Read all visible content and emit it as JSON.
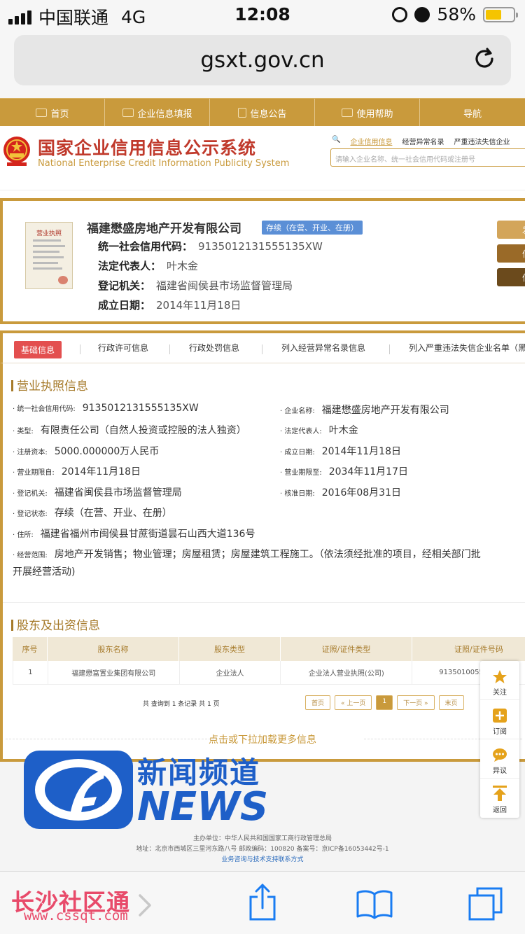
{
  "status_bar": {
    "carrier": "中国联通",
    "network": "4G",
    "time": "12:08",
    "battery": "58%",
    "battery_level": 0.58
  },
  "browser": {
    "url": "gsxt.gov.cn"
  },
  "nav": {
    "items": [
      "首页",
      "企业信息填报",
      "信息公告",
      "使用帮助",
      "导航"
    ]
  },
  "header": {
    "title_cn": "国家企业信用信息公示系统",
    "title_en": "National Enterprise Credit Information Publicity System",
    "search_links": [
      "企业信用信息",
      "经营异常名录",
      "严重违法失信企业"
    ],
    "search_placeholder": "请输入企业名称、统一社会信用代码或注册号"
  },
  "company": {
    "name": "福建懋盛房地产开发有限公司",
    "status_badge": "存续（在营、开业、在册）",
    "license_image_label": "营业执照",
    "fields": [
      {
        "label": "统一社会信用代码：",
        "value": "9135012131555135XW"
      },
      {
        "label": "法定代表人：",
        "value": "叶木金"
      },
      {
        "label": "登记机关：",
        "value": "福建省闽侯县市场监督管理局"
      },
      {
        "label": "成立日期：",
        "value": "2014年11月18日"
      }
    ],
    "side_buttons": [
      "发",
      "信",
      "信"
    ]
  },
  "tabs": {
    "items": [
      "基础信息",
      "行政许可信息",
      "行政处罚信息",
      "列入经营异常名录信息",
      "列入严重违法失信企业名单（黑"
    ]
  },
  "license_section": {
    "title": "营业执照信息",
    "left": [
      {
        "k": "统一社会信用代码:",
        "v": "9135012131555135XW"
      },
      {
        "k": "类型:",
        "v": "有限责任公司（自然人投资或控股的法人独资）"
      },
      {
        "k": "注册资本:",
        "v": "5000.000000万人民币"
      },
      {
        "k": "营业期限自:",
        "v": "2014年11月18日"
      },
      {
        "k": "登记机关:",
        "v": "福建省闽侯县市场监督管理局"
      },
      {
        "k": "登记状态:",
        "v": "存续（在营、开业、在册）"
      }
    ],
    "right": [
      {
        "k": "企业名称:",
        "v": "福建懋盛房地产开发有限公司"
      },
      {
        "k": "法定代表人:",
        "v": "叶木金"
      },
      {
        "k": "成立日期:",
        "v": "2014年11月18日"
      },
      {
        "k": "营业期限至:",
        "v": "2034年11月17日"
      },
      {
        "k": "核准日期:",
        "v": "2016年08月31日"
      }
    ],
    "address_k": "住所:",
    "address_v": "福建省福州市闽侯县甘蔗街道昙石山西大道136号",
    "scope_k": "经营范围:",
    "scope_v1": "房地产开发销售；物业管理；房屋租赁；房屋建筑工程施工。（依法须经批准的项目，经相关部门批",
    "scope_v2": "开展经营活动)"
  },
  "shareholder_section": {
    "title": "股东及出资信息",
    "headers": [
      "序号",
      "股东名称",
      "股东类型",
      "证照/证件类型",
      "证照/证件号码"
    ],
    "rows": [
      [
        "1",
        "福建懋富置业集团有限公司",
        "企业法人",
        "企业法人营业执照(公司)",
        "9135010055"
      ]
    ],
    "total": "共 查询到 1 条记录 共 1 页",
    "pager": [
      "首页",
      "« 上一页",
      "1",
      "下一页 »",
      "末页"
    ],
    "load_more": "点击或下拉加载更多信息"
  },
  "float_panel": {
    "items": [
      "关注",
      "订阅",
      "异议",
      "返回"
    ]
  },
  "footer": {
    "line1": "主办单位：中华人民共和国国家工商行政管理总局",
    "line2": "地址：北京市西城区三里河东路八号    邮政编码：100820    备案号：京ICP备16053442号-1",
    "line3": "业务咨询与技术支持联系方式"
  },
  "watermark": {
    "brand_cn": "新闻频道",
    "brand_en": "NEWS",
    "site_cn": "长沙社区通",
    "site_url": "www.cssqt.com"
  }
}
